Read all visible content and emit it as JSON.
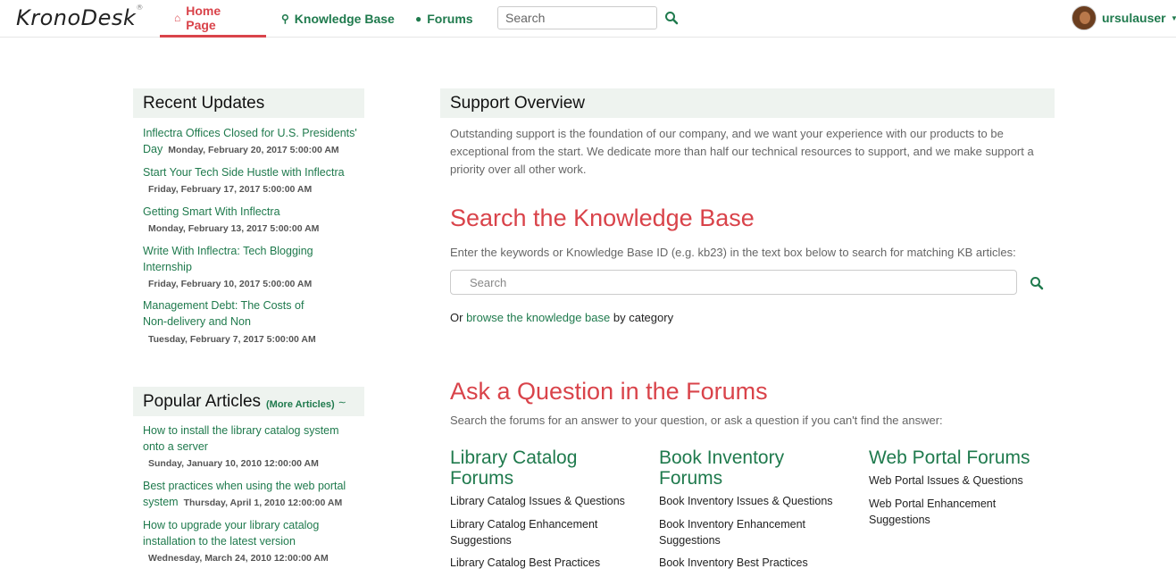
{
  "app": {
    "logo_text": "KronoDesk",
    "logo_reg": "®"
  },
  "nav": {
    "home_label": "Home Page",
    "kb_label": "Knowledge Base",
    "forums_label": "Forums",
    "search_placeholder": "Search",
    "user_name": "ursulauser",
    "active_tab": "Home Page",
    "accent_color": "#d9434a",
    "link_color": "#1f7a4d"
  },
  "recent": {
    "title": "Recent Updates",
    "items": [
      {
        "title": "Inflectra Offices Closed for U.S. Presidents' Day",
        "date": "Monday, February 20, 2017 5:00:00 AM"
      },
      {
        "title": "Start Your Tech Side Hustle with Inflectra",
        "date": "Friday, February 17, 2017 5:00:00 AM"
      },
      {
        "title": "Getting Smart With Inflectra",
        "date": "Monday, February 13, 2017 5:00:00 AM"
      },
      {
        "title": "Write With Inflectra: Tech Blogging Internship",
        "date": "Friday, February 10, 2017 5:00:00 AM"
      },
      {
        "title": "Management Debt: The Costs of Non-delivery and Non",
        "date": "Tuesday, February 7, 2017 5:00:00 AM"
      }
    ]
  },
  "popular": {
    "title": "Popular Articles",
    "more_label": "(More Articles)",
    "items": [
      {
        "title": "How to install the library catalog system onto a server",
        "date": "Sunday, January 10, 2010 12:00:00 AM"
      },
      {
        "title": "Best practices when using the web portal system",
        "date": "Thursday, April 1, 2010 12:00:00 AM"
      },
      {
        "title": "How to upgrade your library catalog installation to the latest version",
        "date": "Wednesday, March 24, 2010 12:00:00 AM"
      }
    ]
  },
  "overview": {
    "title": "Support Overview",
    "text": "Outstanding support is the foundation of our company, and we want your experience with our products to be exceptional from the start. We dedicate more than half our technical resources to support, and we make support a priority over all other work."
  },
  "kb": {
    "heading": "Search the Knowledge Base",
    "desc": "Enter the keywords or Knowledge Base ID (e.g. kb23) in the text box below to search for matching KB articles:",
    "search_placeholder": "Search",
    "browse_prefix": "Or",
    "browse_link": "browse the knowledge base",
    "browse_suffix": "by category"
  },
  "forums": {
    "heading": "Ask a Question in the Forums",
    "desc": "Search the forums for an answer to your question, or ask a question if you can't find the answer:",
    "groups": [
      {
        "title": "Library Catalog Forums",
        "links": [
          "Library Catalog Issues & Questions",
          "Library Catalog Enhancement Suggestions",
          "Library Catalog Best Practices"
        ]
      },
      {
        "title": "Book Inventory Forums",
        "links": [
          "Book Inventory Issues & Questions",
          "Book Inventory Enhancement Suggestions",
          "Book Inventory Best Practices"
        ]
      },
      {
        "title": "Web Portal Forums",
        "links": [
          "Web Portal Issues & Questions",
          "Web Portal Enhancement Suggestions"
        ]
      }
    ]
  }
}
